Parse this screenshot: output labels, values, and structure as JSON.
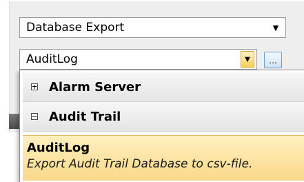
{
  "export_type_combo": {
    "selected": "Database Export",
    "arrow": "▼"
  },
  "log_combo": {
    "selected": "AuditLog",
    "arrow": "▼"
  },
  "browse_button": {
    "label": "..."
  },
  "dropdown": {
    "groups": [
      {
        "label": "Alarm Server",
        "state": "collapsed",
        "toggle_icon": "plus-icon"
      },
      {
        "label": "Audit Trail",
        "state": "expanded",
        "toggle_icon": "minus-icon"
      }
    ],
    "selected_item": {
      "title": "AuditLog",
      "description": "Export Audit Trail Database to csv-file."
    }
  },
  "colors": {
    "highlight_top": "#fff0bf",
    "highlight_bottom": "#fad98a",
    "combo_button": "#f7cf59",
    "browse_border": "#6f9dc6"
  }
}
